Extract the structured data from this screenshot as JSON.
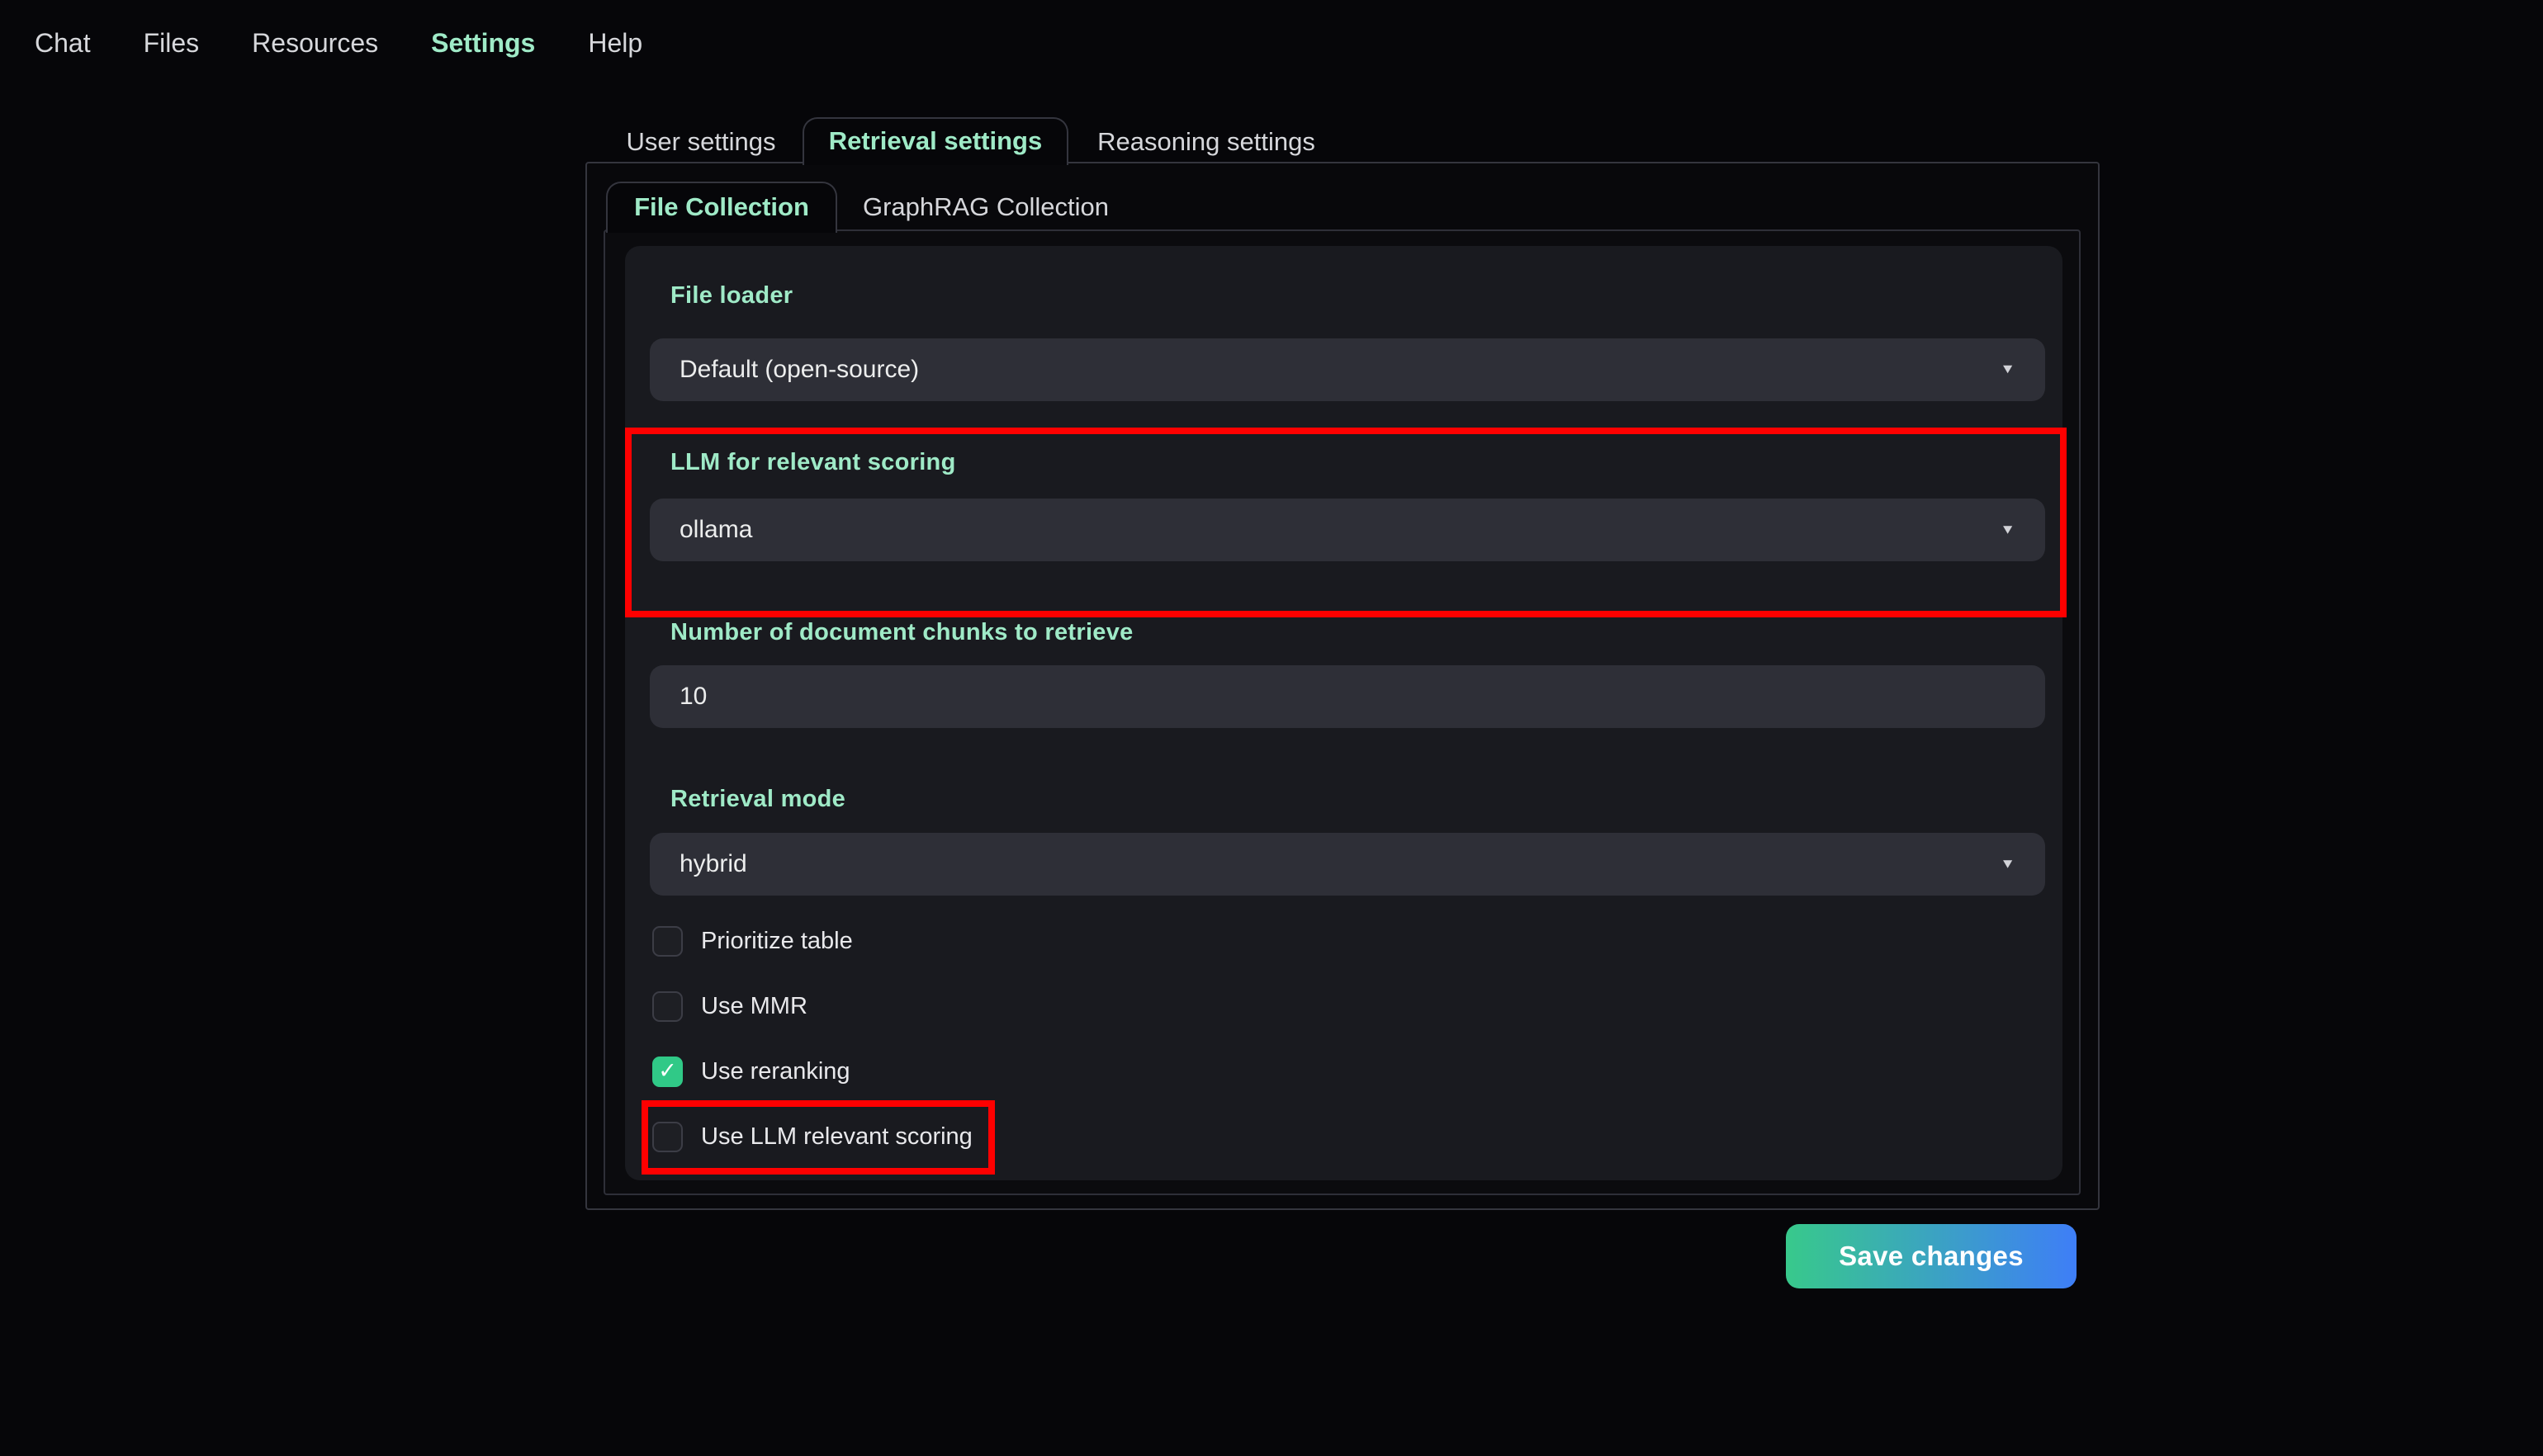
{
  "nav": {
    "items": [
      {
        "label": "Chat",
        "active": false
      },
      {
        "label": "Files",
        "active": false
      },
      {
        "label": "Resources",
        "active": false
      },
      {
        "label": "Settings",
        "active": true
      },
      {
        "label": "Help",
        "active": false
      }
    ]
  },
  "tabs": {
    "items": [
      {
        "label": "User settings",
        "active": false
      },
      {
        "label": "Retrieval settings",
        "active": true
      },
      {
        "label": "Reasoning settings",
        "active": false
      }
    ]
  },
  "subtabs": {
    "items": [
      {
        "label": "File Collection",
        "active": true
      },
      {
        "label": "GraphRAG Collection",
        "active": false
      }
    ]
  },
  "form": {
    "file_loader": {
      "label": "File loader",
      "value": "Default (open-source)"
    },
    "llm_scoring": {
      "label": "LLM for relevant scoring",
      "value": "ollama"
    },
    "num_chunks": {
      "label": "Number of document chunks to retrieve",
      "value": "10"
    },
    "retrieval_mode": {
      "label": "Retrieval mode",
      "value": "hybrid"
    },
    "checkboxes": [
      {
        "label": "Prioritize table",
        "checked": false
      },
      {
        "label": "Use MMR",
        "checked": false
      },
      {
        "label": "Use reranking",
        "checked": true
      },
      {
        "label": "Use LLM relevant scoring",
        "checked": false
      }
    ]
  },
  "actions": {
    "save_label": "Save changes"
  },
  "icons": {
    "caret": "▼",
    "check": "✓"
  },
  "colors": {
    "page_bg": "#060609",
    "panel_border": "#34353e",
    "group_bg": "#191a1f",
    "input_bg": "#2e2f37",
    "accent_mint": "#9feac7",
    "highlight_red": "#fe0000",
    "checkbox_checked": "#30c987",
    "save_gradient_start": "#38c98b",
    "save_gradient_end": "#3e7ef7",
    "text_primary": "#e6e6ea",
    "text_secondary": "#d6d7db"
  }
}
